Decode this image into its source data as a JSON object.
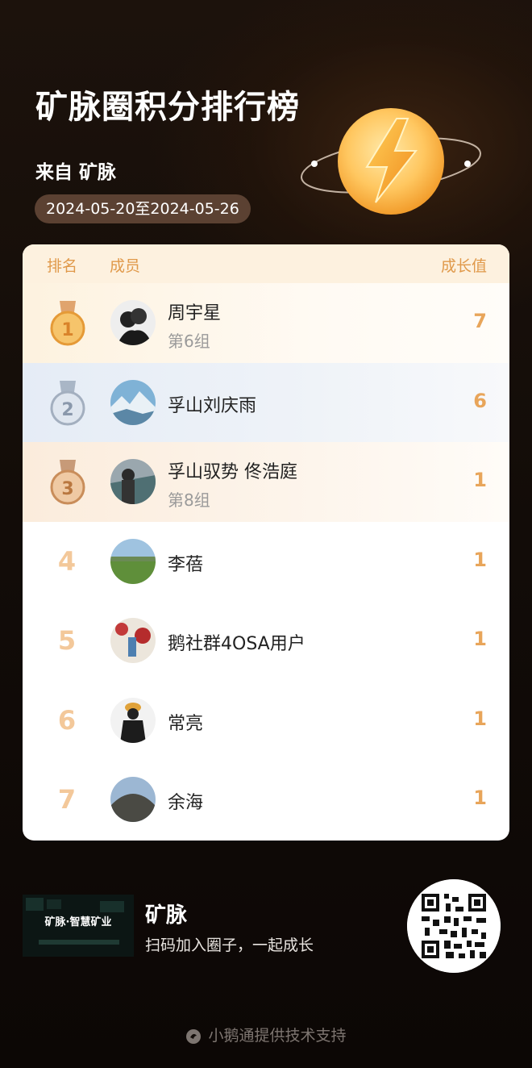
{
  "header": {
    "title": "矿脉圈积分排行榜",
    "source": "来自 矿脉",
    "date_range": "2024-05-20至2024-05-26"
  },
  "table": {
    "columns": {
      "rank": "排名",
      "member": "成员",
      "score": "成长值"
    },
    "rows": [
      {
        "rank": "1",
        "name": "周宇星",
        "group": "第6组",
        "score": "7",
        "medal": "gold"
      },
      {
        "rank": "2",
        "name": "孚山刘庆雨",
        "group": "",
        "score": "6",
        "medal": "silver"
      },
      {
        "rank": "3",
        "name": "孚山驭势 佟浩庭",
        "group": "第8组",
        "score": "1",
        "medal": "bronze"
      },
      {
        "rank": "4",
        "name": "李蓓",
        "group": "",
        "score": "1"
      },
      {
        "rank": "5",
        "name": "鹅社群4OSA用户",
        "group": "",
        "score": "1"
      },
      {
        "rank": "6",
        "name": "常亮",
        "group": "",
        "score": "1"
      },
      {
        "rank": "7",
        "name": "余海",
        "group": "",
        "score": "1"
      }
    ]
  },
  "footer": {
    "banner_text": "矿脉·智慧矿业",
    "title": "矿脉",
    "subtitle": "扫码加入圈子，一起成长",
    "credit": "小鹅通提供技术支持"
  },
  "colors": {
    "accent": "#e8a55a",
    "header_bg": "#fdf1df",
    "pill_bg": "#5b4132"
  }
}
